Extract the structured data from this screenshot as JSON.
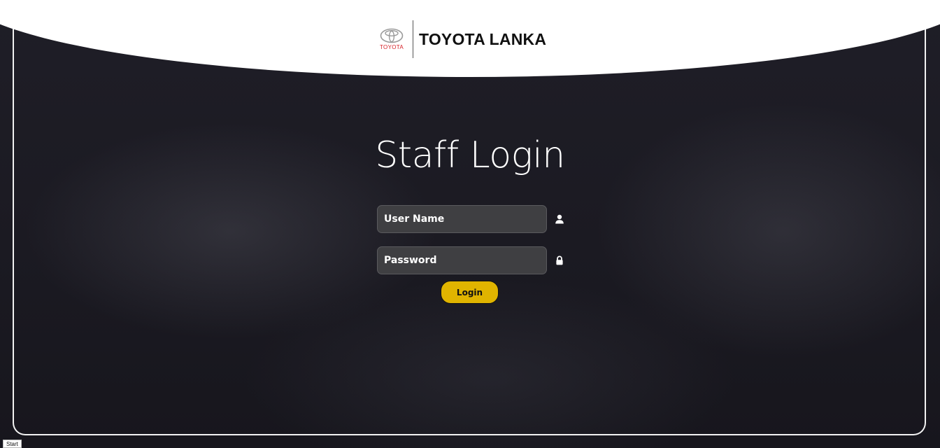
{
  "header": {
    "logo_text": "TOYOTA",
    "brand_name": "TOYOTA LANKA"
  },
  "login": {
    "title": "Staff Login",
    "username": {
      "placeholder": "User Name",
      "icon": "user-icon"
    },
    "password": {
      "placeholder": "Password",
      "icon": "lock-icon"
    },
    "submit_label": "Login"
  },
  "taskbar": {
    "start_label": "Start"
  },
  "colors": {
    "accent": "#e0b400",
    "background": "#1c1b23",
    "header": "#ffffff",
    "brand_red": "#d61f26"
  }
}
